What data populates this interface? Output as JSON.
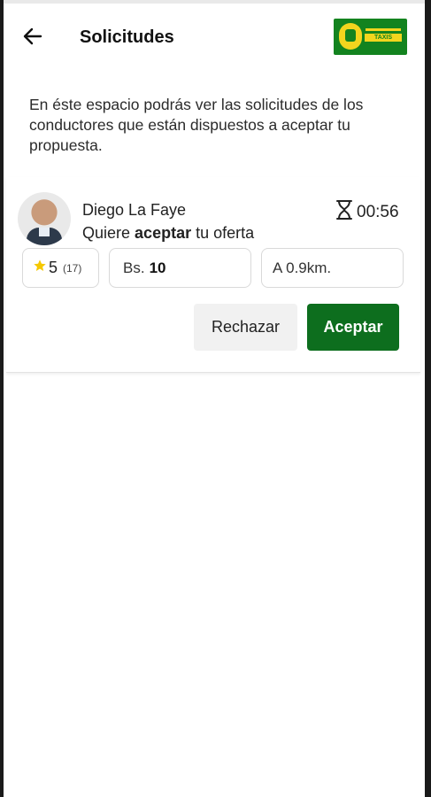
{
  "header": {
    "title": "Solicitudes",
    "logo_text": "TAXIS"
  },
  "description": "En éste espacio podrás ver las solicitudes de los conductores que están dispuestos a aceptar tu propuesta.",
  "request": {
    "driver_name": "Diego La Faye",
    "timer": "00:56",
    "message_prefix": "Quiere",
    "message_bold": "aceptar",
    "message_suffix": "tu oferta",
    "rating": "5",
    "rating_count": "(17)",
    "price_prefix": "Bs.",
    "price_value": "10",
    "distance": "A 0.9km.",
    "reject_label": "Rechazar",
    "accept_label": "Aceptar"
  },
  "colors": {
    "accent_green": "#0d6e1e",
    "logo_green": "#13831f",
    "logo_yellow": "#f2d51e",
    "star": "#f5c800"
  }
}
